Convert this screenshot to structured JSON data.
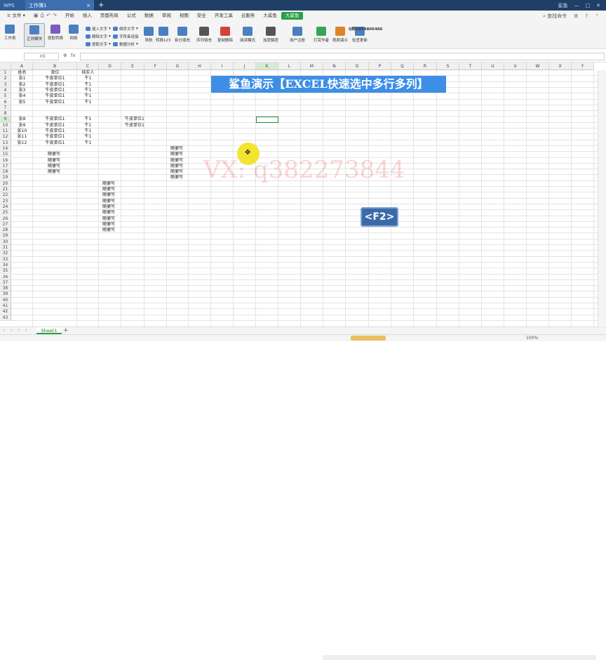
{
  "titlebar": {
    "app_tab": "WPS",
    "doc_tab": "工作簿1",
    "new_tab": "+",
    "controls": [
      "—",
      "□",
      "✕"
    ],
    "user": "鲨鱼"
  },
  "menubar": {
    "file": "文件",
    "items": [
      "开始",
      "插入",
      "页面布局",
      "公式",
      "数据",
      "审阅",
      "视图",
      "安全",
      "开发工具",
      "云服务",
      "大鲨鱼"
    ],
    "active": "大鲨鱼",
    "search": "查找命令"
  },
  "ribbon": {
    "big": [
      {
        "label": "工作表",
        "icon": "worksheet-icon"
      },
      {
        "label": "正则模块",
        "icon": "regex-icon"
      },
      {
        "label": "提取转换",
        "icon": "extract-icon"
      },
      {
        "label": "网络",
        "icon": "network-icon"
      },
      {
        "label": "导航",
        "icon": "navigation-icon"
      },
      {
        "label": "转换123",
        "icon": "convert-icon"
      },
      {
        "label": "拆分填充",
        "icon": "split-fill-icon"
      },
      {
        "label": "序列填充",
        "icon": "sequence-fill-icon"
      },
      {
        "label": "复制删除",
        "icon": "copy-delete-icon"
      },
      {
        "label": "阅读模式",
        "icon": "read-mode-icon"
      },
      {
        "label": "加密解密",
        "icon": "encrypt-icon"
      },
      {
        "label": "用户注册",
        "icon": "user-register-icon"
      },
      {
        "label": "打赏作者",
        "icon": "tip-author-icon"
      },
      {
        "label": "视频演示",
        "icon": "video-demo-icon"
      },
      {
        "label": "检查更新",
        "icon": "check-update-icon"
      }
    ],
    "small": [
      "插入文字",
      "删除文字",
      "提取文字",
      "倒序文字",
      "字符串连接",
      "数据分析"
    ],
    "qq": "Q群1074806486"
  },
  "formula": {
    "namebox": "K9",
    "fx": "fx"
  },
  "columns": [
    "A",
    "B",
    "C",
    "D",
    "E",
    "F",
    "G",
    "H",
    "I",
    "J",
    "K",
    "L",
    "M",
    "N",
    "O",
    "P",
    "Q",
    "R",
    "S",
    "T",
    "U",
    "V",
    "W",
    "X",
    "Y"
  ],
  "selected_column": "K",
  "selected_row": 9,
  "rows": 43,
  "cells": [
    {
      "r": 1,
      "c": "A",
      "v": "姓名"
    },
    {
      "r": 1,
      "c": "B",
      "v": "单位"
    },
    {
      "r": 1,
      "c": "C",
      "v": "核实人"
    },
    {
      "r": 2,
      "c": "A",
      "v": "张1"
    },
    {
      "r": 2,
      "c": "B",
      "v": "牛皮单位1"
    },
    {
      "r": 2,
      "c": "C",
      "v": "牛1"
    },
    {
      "r": 3,
      "c": "A",
      "v": "张2"
    },
    {
      "r": 3,
      "c": "B",
      "v": "牛皮单位1"
    },
    {
      "r": 3,
      "c": "C",
      "v": "牛1"
    },
    {
      "r": 4,
      "c": "A",
      "v": "张3"
    },
    {
      "r": 4,
      "c": "B",
      "v": "牛皮单位1"
    },
    {
      "r": 4,
      "c": "C",
      "v": "牛1"
    },
    {
      "r": 5,
      "c": "A",
      "v": "张4"
    },
    {
      "r": 5,
      "c": "B",
      "v": "牛皮单位1"
    },
    {
      "r": 5,
      "c": "C",
      "v": "牛1"
    },
    {
      "r": 6,
      "c": "A",
      "v": "张5"
    },
    {
      "r": 6,
      "c": "B",
      "v": "牛皮单位1"
    },
    {
      "r": 6,
      "c": "C",
      "v": "牛1"
    },
    {
      "r": 9,
      "c": "A",
      "v": "张8"
    },
    {
      "r": 9,
      "c": "B",
      "v": "牛皮单位1"
    },
    {
      "r": 9,
      "c": "C",
      "v": "牛1"
    },
    {
      "r": 9,
      "c": "E",
      "v": "牛皮单位1"
    },
    {
      "r": 10,
      "c": "A",
      "v": "张9"
    },
    {
      "r": 10,
      "c": "B",
      "v": "牛皮单位1"
    },
    {
      "r": 10,
      "c": "C",
      "v": "牛1"
    },
    {
      "r": 10,
      "c": "E",
      "v": "牛皮单位1"
    },
    {
      "r": 11,
      "c": "A",
      "v": "张10"
    },
    {
      "r": 11,
      "c": "B",
      "v": "牛皮单位1"
    },
    {
      "r": 11,
      "c": "C",
      "v": "牛1"
    },
    {
      "r": 12,
      "c": "A",
      "v": "张11"
    },
    {
      "r": 12,
      "c": "B",
      "v": "牛皮单位1"
    },
    {
      "r": 12,
      "c": "C",
      "v": "牛1"
    },
    {
      "r": 13,
      "c": "A",
      "v": "张12"
    },
    {
      "r": 13,
      "c": "B",
      "v": "牛皮单位1"
    },
    {
      "r": 13,
      "c": "C",
      "v": "牛1"
    },
    {
      "r": 14,
      "c": "G",
      "v": "随便写"
    },
    {
      "r": 15,
      "c": "B",
      "v": "随便写"
    },
    {
      "r": 15,
      "c": "G",
      "v": "随便写"
    },
    {
      "r": 16,
      "c": "B",
      "v": "随便写"
    },
    {
      "r": 16,
      "c": "G",
      "v": "随便写"
    },
    {
      "r": 17,
      "c": "B",
      "v": "随便写"
    },
    {
      "r": 17,
      "c": "G",
      "v": "随便写"
    },
    {
      "r": 18,
      "c": "B",
      "v": "随便写"
    },
    {
      "r": 18,
      "c": "G",
      "v": "随便写"
    },
    {
      "r": 19,
      "c": "G",
      "v": "随便写"
    },
    {
      "r": 20,
      "c": "D",
      "v": "随便写"
    },
    {
      "r": 21,
      "c": "D",
      "v": "随便写"
    },
    {
      "r": 22,
      "c": "D",
      "v": "随便写"
    },
    {
      "r": 23,
      "c": "D",
      "v": "随便写"
    },
    {
      "r": 24,
      "c": "D",
      "v": "随便写"
    },
    {
      "r": 25,
      "c": "D",
      "v": "随便写"
    },
    {
      "r": 26,
      "c": "D",
      "v": "随便写"
    },
    {
      "r": 27,
      "c": "D",
      "v": "随便写"
    },
    {
      "r": 28,
      "c": "D",
      "v": "随便写"
    }
  ],
  "overlay": {
    "banner": "鲨鱼演示【EXCEL快速选中多行多列】",
    "watermark": "VX: q382273844",
    "keycap": "<F2>"
  },
  "sheet_tabs": {
    "tab": "Sheet1",
    "add": "+"
  },
  "status": {
    "zoom": "100%"
  }
}
